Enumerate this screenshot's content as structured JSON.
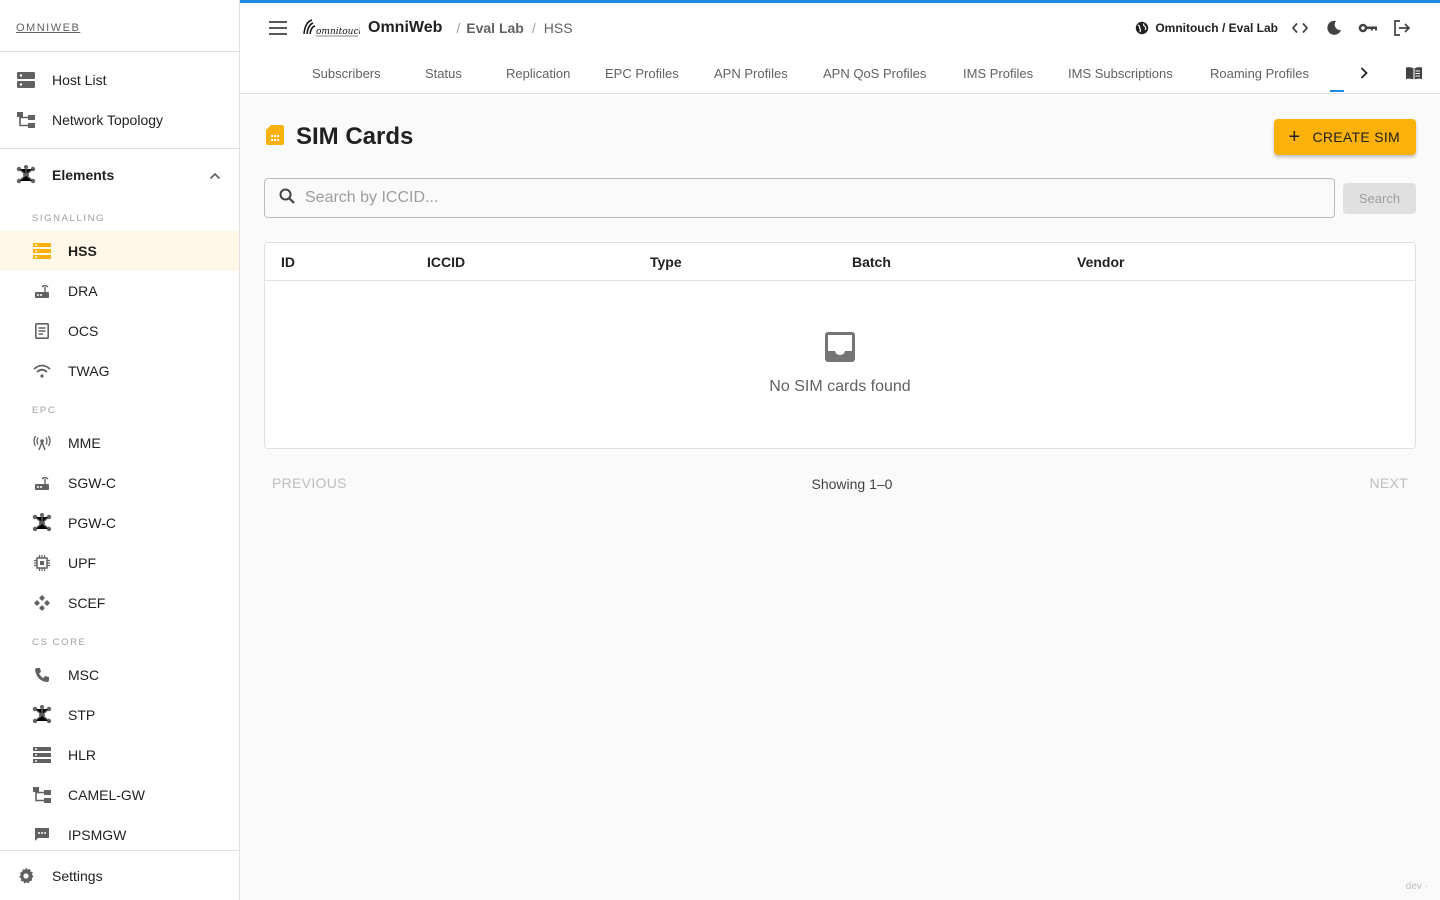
{
  "brand": "OMNIWEB",
  "sidebar": {
    "top_items": [
      {
        "label": "Host List",
        "icon": "dns-icon"
      },
      {
        "label": "Network Topology",
        "icon": "account-tree-icon"
      }
    ],
    "elements_label": "Elements",
    "sections": [
      {
        "label": "SIGNALLING",
        "items": [
          {
            "label": "HSS",
            "icon": "storage-icon",
            "active": true
          },
          {
            "label": "DRA",
            "icon": "router-icon"
          },
          {
            "label": "OCS",
            "icon": "receipt-icon"
          },
          {
            "label": "TWAG",
            "icon": "wifi-icon"
          }
        ]
      },
      {
        "label": "EPC",
        "items": [
          {
            "label": "MME",
            "icon": "antenna-icon"
          },
          {
            "label": "SGW-C",
            "icon": "router-icon"
          },
          {
            "label": "PGW-C",
            "icon": "hub-icon"
          },
          {
            "label": "UPF",
            "icon": "chip-icon"
          },
          {
            "label": "SCEF",
            "icon": "api-icon"
          }
        ]
      },
      {
        "label": "CS CORE",
        "items": [
          {
            "label": "MSC",
            "icon": "phone-icon"
          },
          {
            "label": "STP",
            "icon": "hub-icon"
          },
          {
            "label": "HLR",
            "icon": "list-icon"
          },
          {
            "label": "CAMEL-GW",
            "icon": "account-tree-icon"
          },
          {
            "label": "IPSMGW",
            "icon": "sms-icon"
          }
        ]
      }
    ],
    "settings_label": "Settings"
  },
  "topbar": {
    "app_name": "OmniWeb",
    "logo_text": "omnitouch",
    "breadcrumb": [
      "Eval Lab",
      "HSS"
    ],
    "tenant": "Omnitouch / Eval Lab"
  },
  "tabs": [
    "Subscribers",
    "Status",
    "Replication",
    "EPC Profiles",
    "APN Profiles",
    "APN QoS Profiles",
    "IMS Profiles",
    "IMS Subscriptions",
    "Roaming Profiles"
  ],
  "page": {
    "title": "SIM Cards",
    "create_label": "CREATE SIM",
    "search_placeholder": "Search by ICCID...",
    "search_button": "Search"
  },
  "table": {
    "columns": [
      "ID",
      "ICCID",
      "Type",
      "Batch",
      "Vendor"
    ],
    "empty_text": "No SIM cards found"
  },
  "pager": {
    "prev": "PREVIOUS",
    "showing": "Showing 1–0",
    "next": "NEXT"
  },
  "footer_tag": "dev ·",
  "colors": {
    "accent": "#fbb10b",
    "active_bg": "#fff8e8",
    "primary": "#1e88e5"
  }
}
